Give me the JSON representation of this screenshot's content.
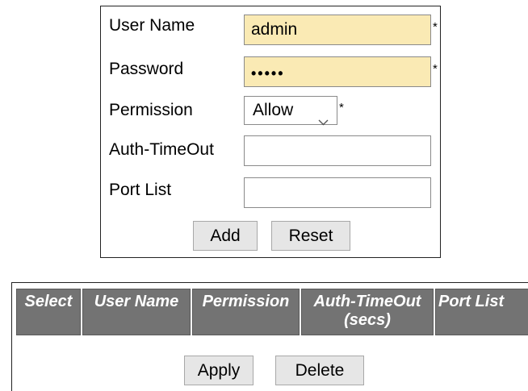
{
  "form": {
    "username": {
      "label": "User Name",
      "value": "admin",
      "required_mark": "*"
    },
    "password": {
      "label": "Password",
      "value": "•••••",
      "required_mark": "*"
    },
    "permission": {
      "label": "Permission",
      "selected": "Allow",
      "required_mark": "*"
    },
    "auth_timeout": {
      "label": "Auth-TimeOut",
      "value": ""
    },
    "port_list": {
      "label": "Port List",
      "value": ""
    },
    "add_label": "Add",
    "reset_label": "Reset"
  },
  "table": {
    "columns": [
      "Select",
      "User Name",
      "Permission",
      "Auth-TimeOut\n(secs)",
      "Port List"
    ],
    "col_select": "Select",
    "col_username": "User Name",
    "col_permission": "Permission",
    "col_auth_line1": "Auth-TimeOut",
    "col_auth_line2": "(secs)",
    "col_portlist": "Port List",
    "apply_label": "Apply",
    "delete_label": "Delete"
  },
  "colors": {
    "required_field_bg": "#faeab4",
    "header_bg": "#737373",
    "header_text": "#ffffff",
    "button_bg": "#e6e6e6"
  },
  "icons": {
    "select_chevron": "chevron-down-icon"
  }
}
